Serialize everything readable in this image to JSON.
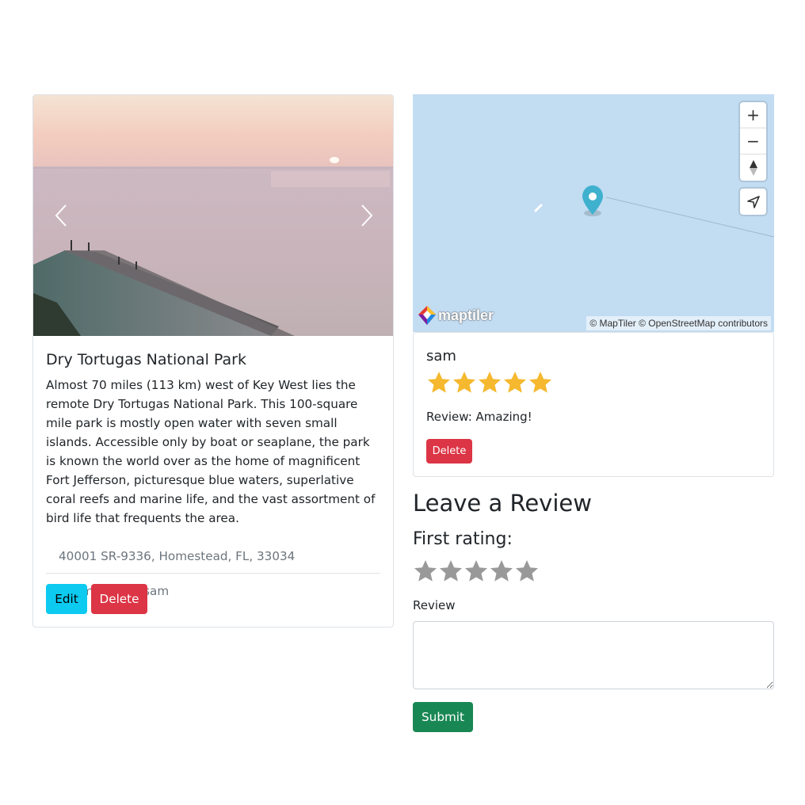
{
  "campground": {
    "title": "Dry Tortugas National Park",
    "description": "Almost 70 miles (113 km) west of Key West lies the remote Dry Tortugas National Park. This 100-square mile park is mostly open water with seven small islands. Accessible only by boat or seaplane, the park is known the world over as the home of magnificent Fort Jefferson, picturesque blue waters, superlative coral reefs and marine life, and the vast assortment of bird life that frequents the area.",
    "location": "40001 SR-9336, Homestead, FL, 33034",
    "submitted_by": "Submitted by sam",
    "edit_label": "Edit",
    "delete_label": "Delete"
  },
  "carousel": {
    "prev_icon": "chevron-left-icon",
    "next_icon": "chevron-right-icon"
  },
  "map": {
    "zoom_in": "+",
    "zoom_out": "−",
    "attribution": "© MapTiler © OpenStreetMap contributors",
    "logo_text": "maptiler",
    "marker_color": "#3fb1ce"
  },
  "review": {
    "author": "sam",
    "rating": 5,
    "max_rating": 5,
    "text": "Review: Amazing!",
    "delete_label": "Delete"
  },
  "review_form": {
    "heading": "Leave a Review",
    "rating_label": "First rating:",
    "rating": 0,
    "max_rating": 5,
    "review_label": "Review",
    "review_value": "",
    "submit_label": "Submit"
  },
  "colors": {
    "star_filled": "#f5b82e",
    "star_empty": "#999999",
    "danger": "#dc3545",
    "info": "#0dcaf0",
    "success": "#198754",
    "map_water": "#c2dcf2"
  }
}
